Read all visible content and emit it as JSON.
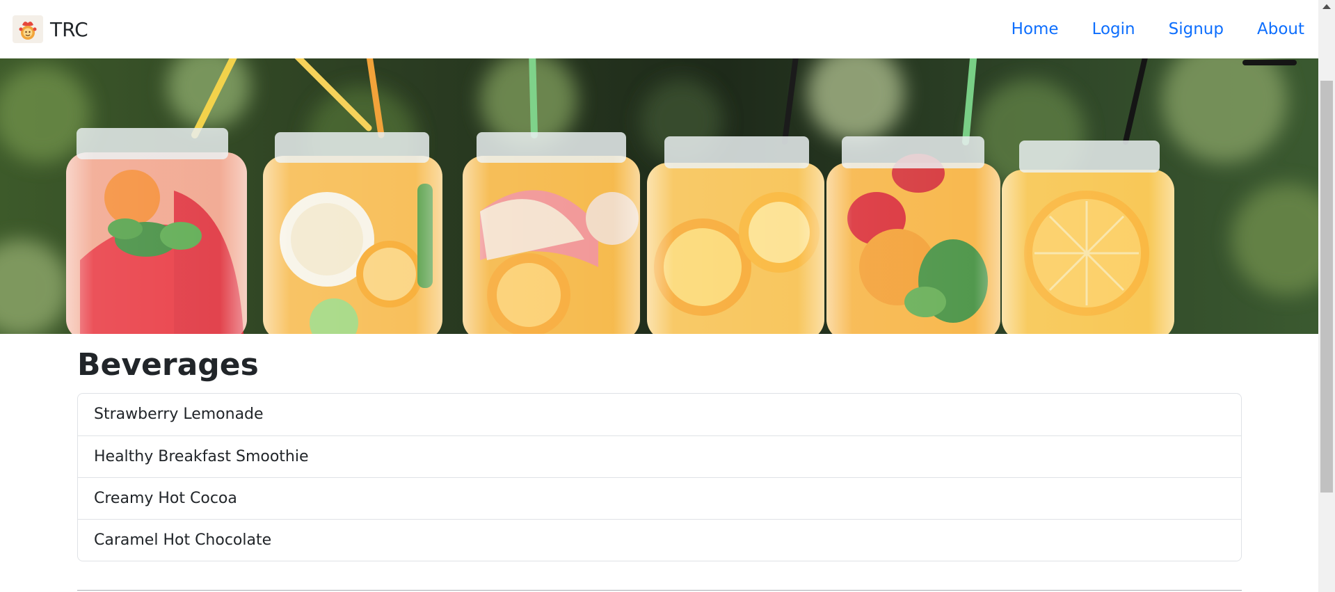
{
  "navbar": {
    "brand": "TRC",
    "brand_logo_icon": "chef-logo-icon",
    "links": [
      "Home",
      "Login",
      "Signup",
      "About"
    ],
    "link_color": "#0d6efd"
  },
  "hero": {
    "image": "fruit-infused-water-jars-photo",
    "jars": 6
  },
  "main": {
    "heading": "Beverages",
    "items": [
      "Strawberry Lemonade",
      "Healthy Breakfast Smoothie",
      "Creamy Hot Cocoa",
      "Caramel Hot Chocolate"
    ]
  }
}
